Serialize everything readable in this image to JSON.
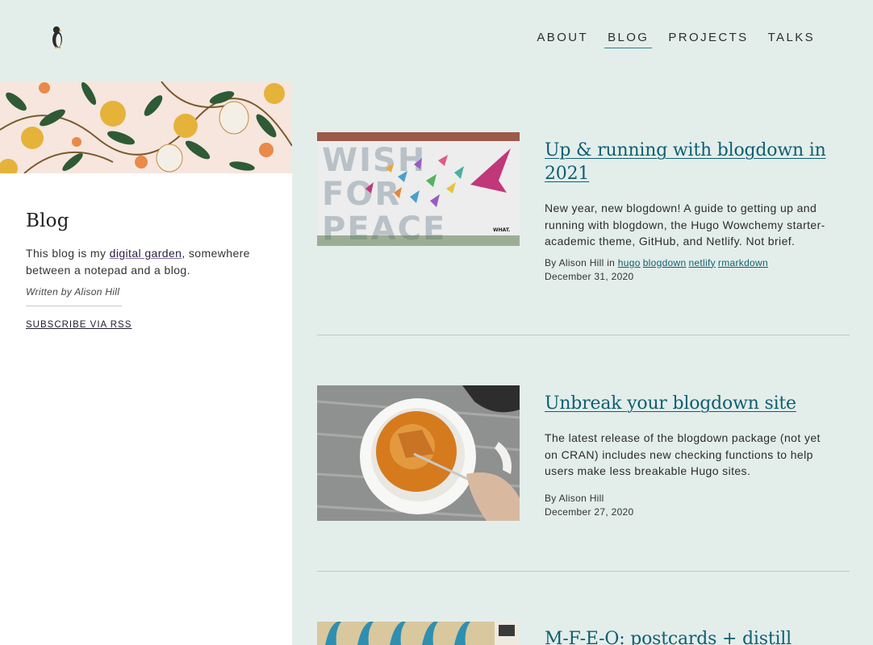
{
  "nav": {
    "items": [
      {
        "label": "ABOUT",
        "active": false
      },
      {
        "label": "BLOG",
        "active": true
      },
      {
        "label": "PROJECTS",
        "active": false
      },
      {
        "label": "TALKS",
        "active": false
      }
    ]
  },
  "sidebar": {
    "title": "Blog",
    "desc_before": "This blog is my ",
    "desc_link": "digital garden",
    "desc_after": ", somewhere between a notepad and a blog.",
    "author": "Written by Alison Hill",
    "rss": "SUBSCRIBE VIA RSS"
  },
  "posts": [
    {
      "title": "Up & running with blogdown in 2021",
      "summary": "New year, new blogdown! A guide to getting up and running with blogdown, the Hugo Wowchemy starter-academic theme, GitHub, and Netlify. Not brief.",
      "byline": "By Alison Hill",
      "in_word": " in ",
      "tags": [
        "hugo",
        "blogdown",
        "netlify",
        "rmarkdown"
      ],
      "date": "December 31, 2020",
      "image_text": [
        "WISH",
        "FOR",
        "PEACE"
      ],
      "image_sign": "WHAT."
    },
    {
      "title": "Unbreak your blogdown site",
      "summary": "The latest release of the blogdown package (not yet on CRAN) includes new checking functions to help users make less breakable Hugo sites.",
      "byline": "By Alison Hill",
      "date": "December 27, 2020"
    },
    {
      "title": "M-F-E-O: postcards + distill"
    }
  ],
  "colors": {
    "background": "#e3eeeb",
    "sidebar": "#ffffff",
    "link": "#0f5f71",
    "nav_active_underline": "#2e7d8c"
  }
}
